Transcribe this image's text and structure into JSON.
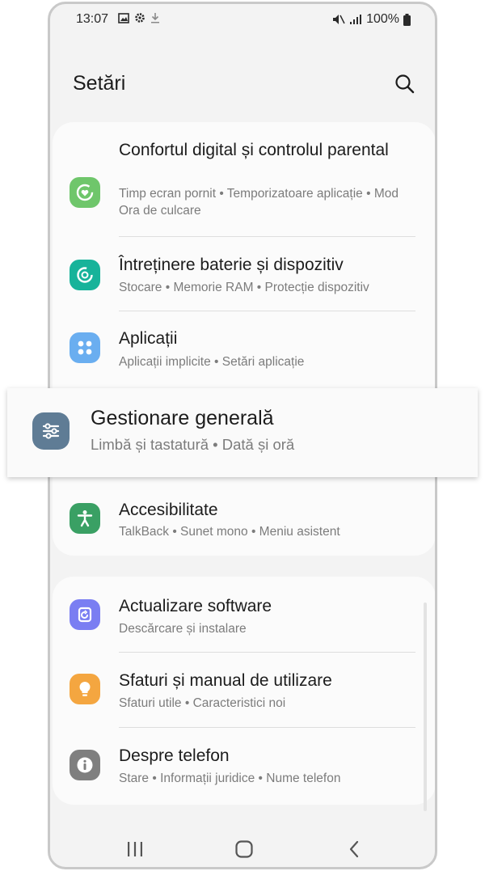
{
  "status": {
    "time": "13:07",
    "battery": "100%"
  },
  "header": {
    "title": "Setări"
  },
  "items": [
    {
      "title": "Confortul digital și controlul parental",
      "subtitle": "Timp ecran pornit  •  Temporizatoare aplicație  •  Mod Ora de culcare",
      "icon": "digital-wellbeing-icon",
      "color": "#6fc66b"
    },
    {
      "title": "Întreținere baterie și dispozitiv",
      "subtitle": "Stocare  •  Memorie RAM  •  Protecție dispozitiv",
      "icon": "device-care-icon",
      "color": "#17b39a"
    },
    {
      "title": "Aplicații",
      "subtitle": "Aplicații implicite  •  Setări aplicație",
      "icon": "apps-icon",
      "color": "#6aaef0"
    },
    {
      "title": "Gestionare generală",
      "subtitle": "Limbă și tastatură  •  Dată și oră",
      "icon": "general-management-icon",
      "color": "#5f7c95"
    },
    {
      "title": "Accesibilitate",
      "subtitle": "TalkBack  •  Sunet mono  •  Meniu asistent",
      "icon": "accessibility-icon",
      "color": "#3aa064"
    },
    {
      "title": "Actualizare software",
      "subtitle": "Descărcare și instalare",
      "icon": "software-update-icon",
      "color": "#7a7ef2"
    },
    {
      "title": "Sfaturi și manual de utilizare",
      "subtitle": "Sfaturi utile  •  Caracteristici noi",
      "icon": "tips-icon",
      "color": "#f4a640"
    },
    {
      "title": "Despre telefon",
      "subtitle": "Stare  •  Informații juridice  •  Nume telefon",
      "icon": "about-phone-icon",
      "color": "#7f7f7f"
    }
  ]
}
